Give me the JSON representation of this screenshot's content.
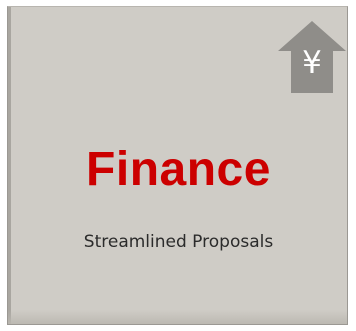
{
  "tile": {
    "title": "Finance",
    "subtitle": "Streamlined Proposals",
    "icon": {
      "name": "yen-house-icon",
      "glyph": "¥",
      "color": "#8f8d89"
    },
    "title_color": "#cc0000",
    "background_color": "#cfccc6"
  }
}
